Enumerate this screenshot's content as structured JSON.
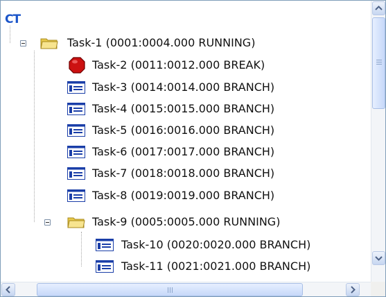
{
  "root": {
    "label": "CT"
  },
  "nodes": [
    {
      "label": "Task-1 (0001:0004.000 RUNNING)",
      "icon": "folder-icon"
    },
    {
      "label": "Task-2 (0011:0012.000 BREAK)",
      "icon": "stop-icon"
    },
    {
      "label": "Task-3 (0014:0014.000 BRANCH)",
      "icon": "branch-icon"
    },
    {
      "label": "Task-4 (0015:0015.000 BRANCH)",
      "icon": "branch-icon"
    },
    {
      "label": "Task-5 (0016:0016.000 BRANCH)",
      "icon": "branch-icon"
    },
    {
      "label": "Task-6 (0017:0017.000 BRANCH)",
      "icon": "branch-icon"
    },
    {
      "label": "Task-7 (0018:0018.000 BRANCH)",
      "icon": "branch-icon"
    },
    {
      "label": "Task-8 (0019:0019.000 BRANCH)",
      "icon": "branch-icon"
    },
    {
      "label": "Task-9 (0005:0005.000 RUNNING)",
      "icon": "folder-icon"
    },
    {
      "label": "Task-10 (0020:0020.000 BRANCH)",
      "icon": "branch-icon"
    },
    {
      "label": "Task-11 (0021:0021.000 BRANCH)",
      "icon": "branch-icon"
    }
  ],
  "colors": {
    "stop": "#cc1111",
    "folder": "#f2d86a",
    "branch": "#1a3ea8",
    "accent": "#1b55c9"
  }
}
